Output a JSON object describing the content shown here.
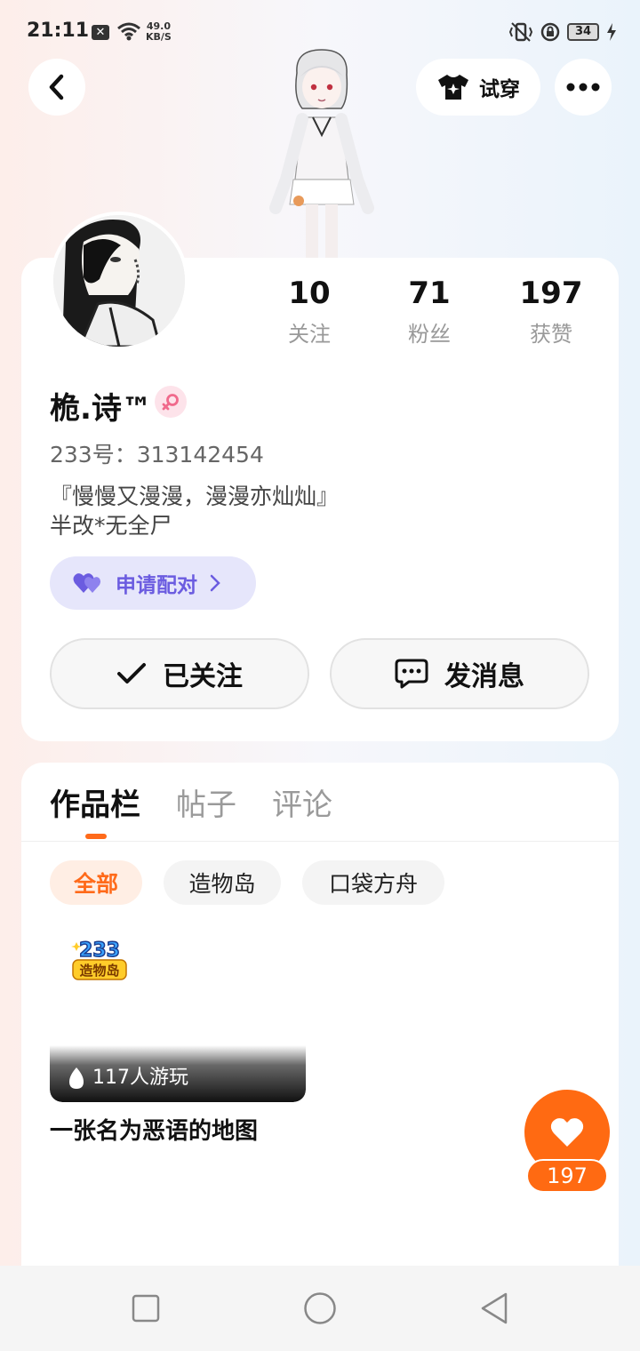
{
  "status_bar": {
    "time": "21:11",
    "net_speed_value": "49.0",
    "net_speed_unit": "KB/S",
    "battery": "34"
  },
  "header": {
    "try_on_label": "试穿",
    "back_icon": "chevron-left-icon",
    "more_icon": "more-dots-icon"
  },
  "profile": {
    "stats": [
      {
        "value": "10",
        "label": "关注"
      },
      {
        "value": "71",
        "label": "粉丝"
      },
      {
        "value": "197",
        "label": "获赞"
      }
    ],
    "nickname": "桅.诗™",
    "gender_icon": "female-icon",
    "uid": "233号：313142454",
    "bio_line1": "『慢慢又漫漫，漫漫亦灿灿』",
    "bio_line2": "半改*无全尸",
    "pair_label": "申请配对",
    "follow_label": "已关注",
    "message_label": "发消息"
  },
  "works": {
    "tabs": [
      "作品栏",
      "帖子",
      "评论"
    ],
    "active_tab": 0,
    "filters": [
      "全部",
      "造物岛",
      "口袋方舟"
    ],
    "active_filter": 0,
    "items": [
      {
        "logo_top": "233",
        "logo_bottom": "造物岛",
        "plays": "117人游玩",
        "title": "一张名为恶语的地图"
      }
    ]
  },
  "like_fab": {
    "count": "197"
  },
  "colors": {
    "accent": "#ff6a12",
    "pair_purple": "#6b5ce0",
    "gender_pink": "#f06a8c"
  }
}
